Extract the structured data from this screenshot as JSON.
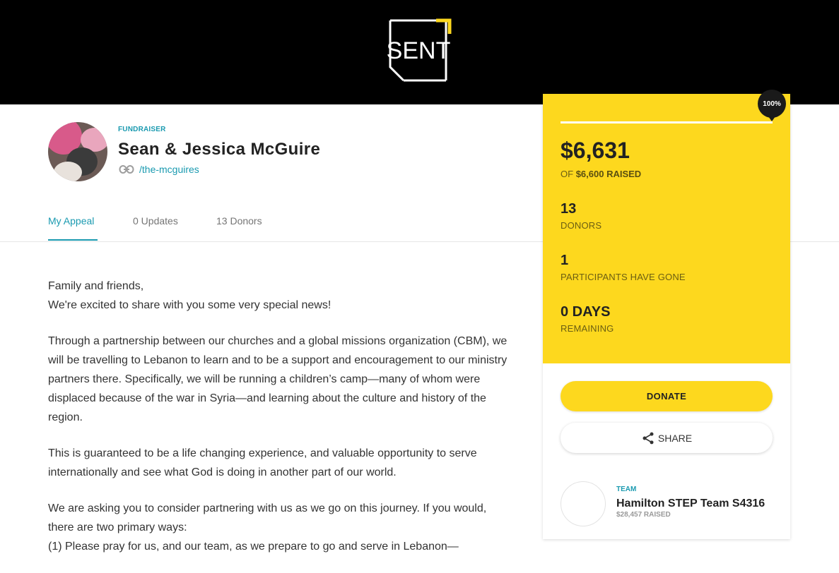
{
  "header": {
    "logo_text": "SENT",
    "brand_color": "#fdd81e"
  },
  "profile": {
    "kind": "FUNDRAISER",
    "name": "Sean & Jessica McGuire",
    "slug": "/the-mcguires",
    "link_icon": "link-icon"
  },
  "tabs": [
    {
      "label": "My Appeal",
      "active": true
    },
    {
      "label": "0 Updates",
      "active": false
    },
    {
      "label": "13 Donors",
      "active": false
    }
  ],
  "story": {
    "p1_line1": "Family and friends,",
    "p1_line2": "We're excited to share with you some very special news!",
    "p2": "Through a partnership between our churches and a global missions organization (CBM), we will be travelling to Lebanon to learn and to be a support and encouragement to our ministry partners there. Specifically, we will be running a children’s camp—many of whom were displaced because of the war in Syria—and learning about the culture and history of the region.",
    "p3": "This is guaranteed to be a life changing experience, and valuable opportunity to serve internationally and see what God is doing in another part of our world.",
    "p4_line1": "We are asking you to consider partnering with us as we go on this journey. If you would, there are two primary ways:",
    "p4_line2": "(1) Please pray for us, and our team, as we prepare to go and serve in Lebanon—"
  },
  "stats": {
    "progress_percent": 100,
    "progress_label": "100%",
    "raised": "$6,631",
    "of_label": "OF",
    "goal": "$6,600",
    "raised_label": "RAISED",
    "donors_count": "13",
    "donors_label": "DONORS",
    "participants_count": "1",
    "participants_label": "PARTICIPANTS HAVE GONE",
    "days_count": "0 DAYS",
    "days_label": "REMAINING"
  },
  "actions": {
    "donate_label": "DONATE",
    "share_label": "SHARE",
    "share_icon": "share-icon"
  },
  "team": {
    "kind": "TEAM",
    "name": "Hamilton STEP Team S4316",
    "raised": "$28,457 RAISED"
  }
}
